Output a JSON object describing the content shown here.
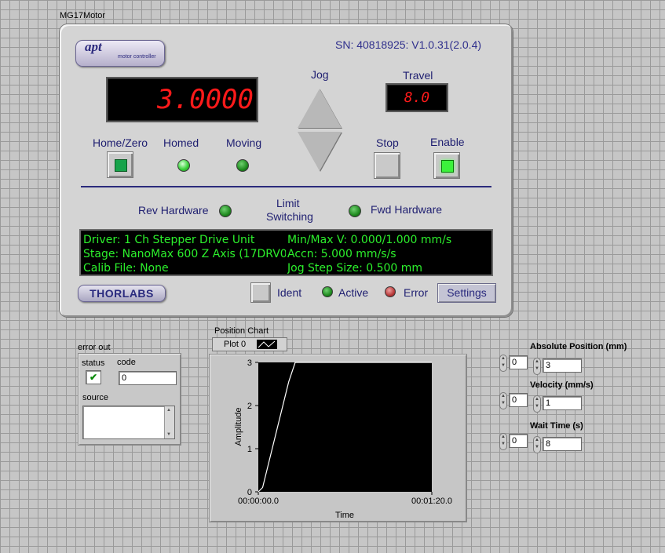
{
  "window": {
    "vi_label": "MG17Motor"
  },
  "apt": {
    "logo_text": "apt",
    "logo_sub": "motor controller",
    "serial": "SN: 40818925: V1.0.31(2.0.4)",
    "position_display": "3.0000",
    "jog_label": "Jog",
    "travel_label": "Travel",
    "travel_value": "8.0",
    "home_zero_label": "Home/Zero",
    "homed_label": "Homed",
    "moving_label": "Moving",
    "stop_label": "Stop",
    "enable_label": "Enable",
    "rev_hw_label": "Rev Hardware",
    "limit_label_1": "Limit",
    "limit_label_2": "Switching",
    "fwd_hw_label": "Fwd Hardware",
    "info": {
      "driver": "Driver: 1 Ch Stepper Drive Unit",
      "stage": "Stage: NanoMax 600 Z Axis (17DRV0",
      "calib": "Calib File: None",
      "minmax": "Min/Max V: 0.000/1.000 mm/s",
      "accn": "Accn: 5.000 mm/s/s",
      "jogstep": "Jog Step Size: 0.500 mm"
    },
    "thorlabs_logo": "THORLABS",
    "ident_label": "Ident",
    "active_label": "Active",
    "error_label": "Error",
    "settings_label": "Settings"
  },
  "error_out": {
    "title": "error out",
    "status_label": "status",
    "code_label": "code",
    "code_value": "0",
    "source_label": "source",
    "status_glyph": "✔"
  },
  "chart": {
    "title": "Position Chart",
    "legend_label": "Plot 0",
    "colors": {
      "plot_bg": "#000000",
      "trace": "#ffffff"
    }
  },
  "chart_data": {
    "type": "line",
    "title": "Position Chart",
    "xlabel": "Time",
    "ylabel": "Amplitude",
    "x_tick_labels": [
      "00:00:00.0",
      "00:01:20.0"
    ],
    "y_ticks": [
      0,
      1,
      2,
      3
    ],
    "ylim": [
      0,
      3
    ],
    "xlim": [
      0,
      80
    ],
    "series": [
      {
        "name": "Plot 0",
        "x": [
          0,
          2,
          14,
          17,
          80
        ],
        "y": [
          0,
          0.1,
          2.55,
          3.0,
          3.0
        ]
      }
    ]
  },
  "controls": {
    "abs_pos": {
      "label": "Absolute Position (mm)",
      "index": "0",
      "value": "3"
    },
    "velocity": {
      "label": "Velocity (mm/s)",
      "index": "0",
      "value": "1"
    },
    "wait_time": {
      "label": "Wait Time (s)",
      "index": "0",
      "value": "8"
    }
  }
}
